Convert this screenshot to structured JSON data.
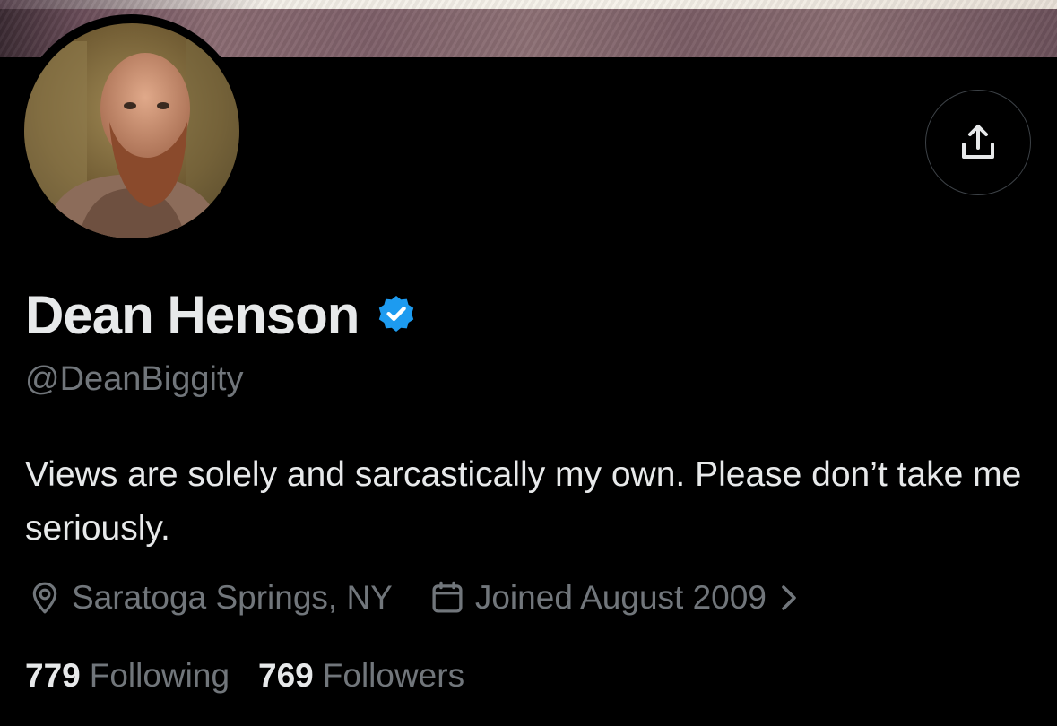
{
  "profile": {
    "display_name": "Dean Henson",
    "handle": "@DeanBiggity",
    "bio": "Views are solely and sarcastically my own. Please don’t take me seriously.",
    "location": "Saratoga Springs, NY",
    "joined": "Joined August 2009",
    "verified": true
  },
  "stats": {
    "following_count": "779",
    "following_label": "Following",
    "followers_count": "769",
    "followers_label": "Followers"
  },
  "icons": {
    "share": "share-icon",
    "verified": "verified-badge-icon",
    "location": "location-pin-icon",
    "calendar": "calendar-icon",
    "chevron": "chevron-right-icon"
  },
  "colors": {
    "background": "#000000",
    "primary_text": "#e7e9ea",
    "secondary_text": "#71767b",
    "verified_blue": "#1d9bf0"
  }
}
